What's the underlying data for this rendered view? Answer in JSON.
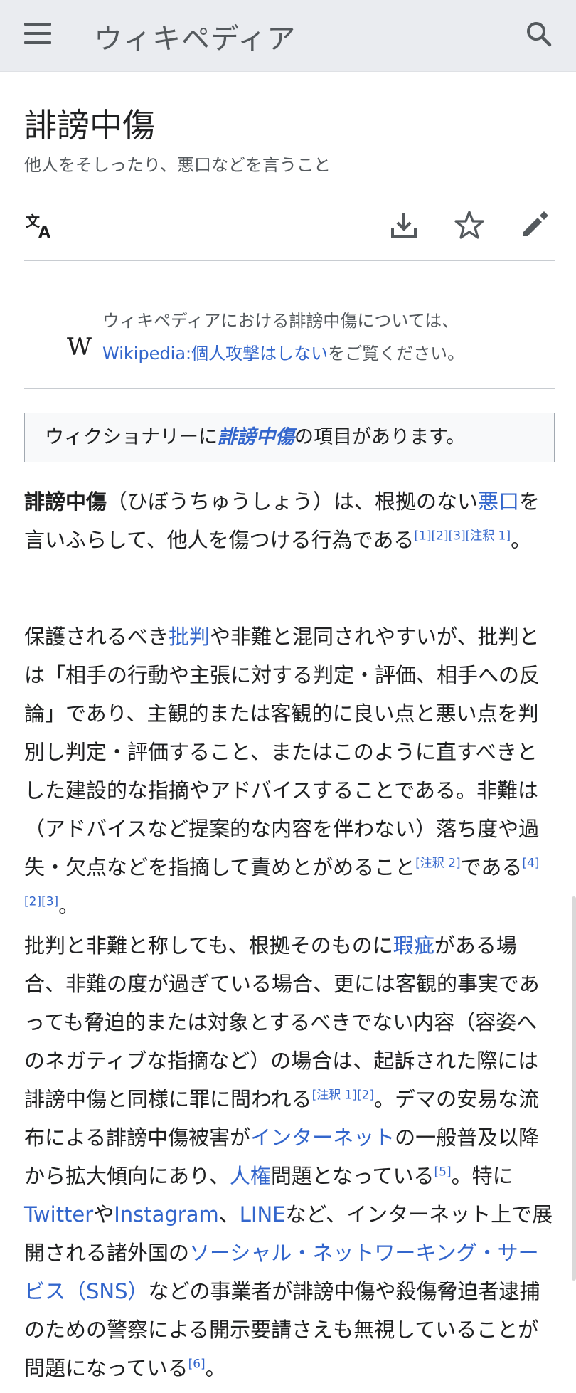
{
  "header": {
    "wordmark": "ウィキペディア"
  },
  "article": {
    "title": "誹謗中傷",
    "subtitle": "他人をそしったり、悪口などを言うこと"
  },
  "hatnote": {
    "logo": "W",
    "line1": "ウィキペディアにおける誹謗中傷については、",
    "link": "Wikipedia:個人攻撃はしない",
    "after": "をご覧ください。"
  },
  "wiktionary": {
    "before": "ウィクショナリーに",
    "term": "誹謗中傷",
    "after": "の項目があります。"
  },
  "p1": {
    "bold": "誹謗中傷",
    "t1": "（ひぼうちゅうしょう）は、根拠のない",
    "l1": "悪口",
    "t2": "を言いふらして、他人を傷つける行為である",
    "refs": "[1][2][3][注釈 1]",
    "end": "。"
  },
  "p2": {
    "t1": "保護されるべき",
    "l1": "批判",
    "t2": "や非難と混同されやすいが、批判とは「相手の行動や主張に対する判定・評価、相手への反論」であり、主観的または客観的に良い点と悪い点を判別し判定・評価すること、またはこのように直すべきとした建設的な指摘やアドバイスすることである。非難は（アドバイスなど提案的な内容を伴わない）落ち度や過失・欠点などを指摘して責めとがめること",
    "r1": "[注釈 2]",
    "t3": "である",
    "r2": "[4][2][3]",
    "end": "。"
  },
  "p3": {
    "t1": "批判と非難と称しても、根拠そのものに",
    "l1": "瑕疵",
    "t2": "がある場合、非難の度が過ぎている場合、更には客観的事実であっても脅迫的または対象とするべきでない内容（容姿へのネガティブな指摘など）の場合は、起訴された際には誹謗中傷と同様に罪に問われる",
    "r1": "[注釈 1][2]",
    "t3": "。デマの安易な流布による誹謗中傷被害が",
    "l2": "インターネット",
    "t4": "の一般普及以降から拡大傾向にあり、",
    "l3": "人権",
    "t5": "問題となっている",
    "r2": "[5]",
    "t6": "。特に",
    "l4": "Twitter",
    "t7": "や",
    "l5": "Instagram",
    "t8": "、",
    "l6": "LINE",
    "t9": "など、インターネット上で展開される諸外国の",
    "l7": "ソーシャル・ネットワーキング・サービス（SNS）",
    "t10": "などの事業者が誹謗中傷や殺傷脅迫者逮捕のための警察による開示要請さえも無視していることが問題になっている",
    "r3": "[6]",
    "end": "。"
  },
  "colors": {
    "link": "#3366cc",
    "header_bg": "#eaecf0",
    "text": "#202122"
  },
  "icons": [
    "menu-icon",
    "search-icon",
    "language-icon",
    "download-icon",
    "star-icon",
    "edit-icon"
  ]
}
